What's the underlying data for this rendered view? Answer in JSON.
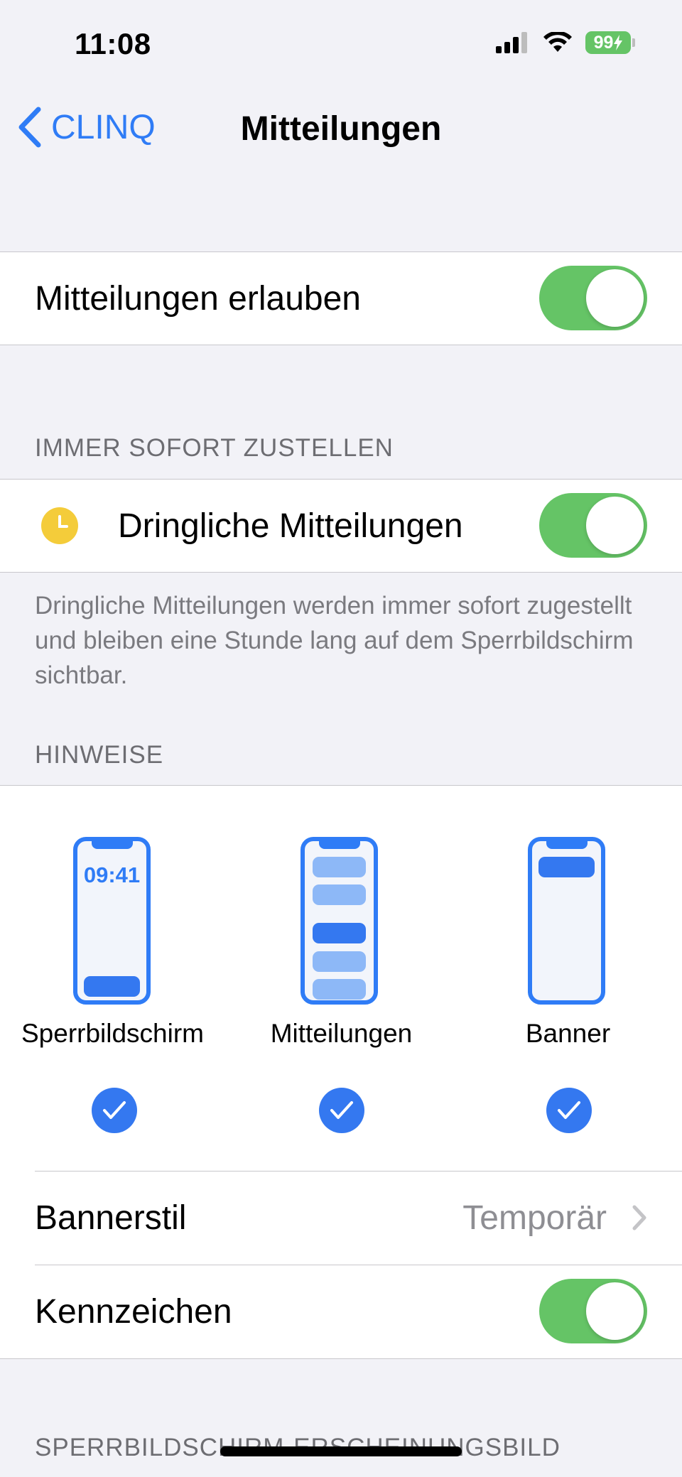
{
  "status_bar": {
    "time": "11:08",
    "battery": "99"
  },
  "nav": {
    "back_label": "CLINQ",
    "title": "Mitteilungen"
  },
  "allow_notifications": {
    "label": "Mitteilungen erlauben",
    "on": true
  },
  "deliver_immediately": {
    "header": "IMMER SOFORT ZUSTELLEN",
    "label": "Dringliche Mitteilungen",
    "on": true,
    "icon": "clock-icon",
    "footer": "Dringliche Mitteilungen werden immer sofort zugestellt und bleiben eine Stunde lang auf dem Sperrbildschirm sichtbar."
  },
  "alerts": {
    "header": "HINWEISE",
    "styles": [
      {
        "label": "Sperrbildschirm",
        "checked": true,
        "preview_time": "09:41"
      },
      {
        "label": "Mitteilungen",
        "checked": true
      },
      {
        "label": "Banner",
        "checked": true
      }
    ],
    "banner_style": {
      "label": "Bannerstil",
      "value": "Temporär"
    },
    "badges": {
      "label": "Kennzeichen",
      "on": true
    }
  },
  "lock_screen_appearance": {
    "header": "SPERRBILDSCHIRM-ERSCHEINUNGSBILD"
  },
  "colors": {
    "accent": "#2f7cf6",
    "toggle_on": "#65c466",
    "clock_icon": "#f4cc3a",
    "background": "#f2f2f7"
  }
}
